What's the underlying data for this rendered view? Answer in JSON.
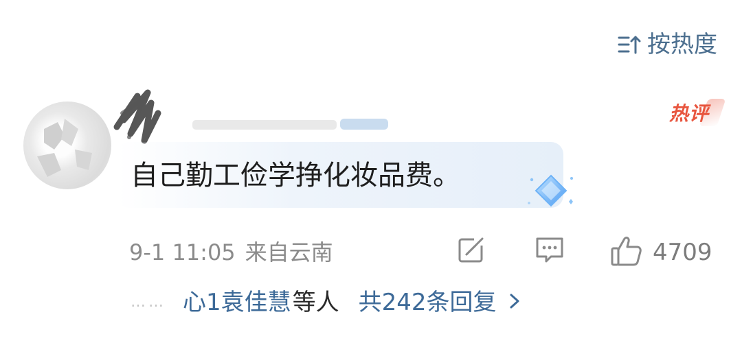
{
  "sort": {
    "label": "按热度",
    "icon": "sort-icon",
    "color": "#4c6f8f"
  },
  "comment": {
    "avatar_icon": "avatar",
    "badge": "热评",
    "badge_color": "#e8553e",
    "text": "自己勤工俭学挣化妆品费。",
    "decoration_icon": "diamond-gem-icon",
    "timestamp": "9-1 11:05",
    "location": "来自云南",
    "likes": "4709"
  },
  "actions": {
    "share_icon": "share-icon",
    "comment_icon": "comment-icon",
    "like_icon": "thumbs-up-icon"
  },
  "replies": {
    "dots": "……",
    "reply_user": "心1袁佳慧",
    "others": "等人",
    "total": "共242条回复",
    "chevron_icon": "chevron-right-icon",
    "link_color": "#3d6a98"
  }
}
